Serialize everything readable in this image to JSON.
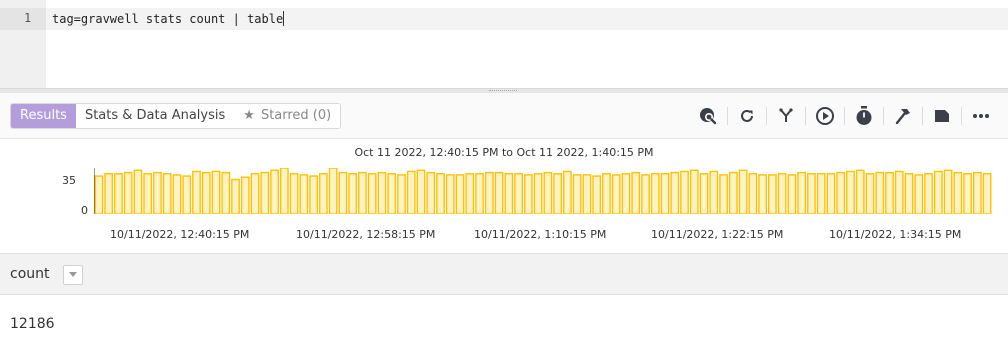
{
  "editor": {
    "line_number": "1",
    "query": "tag=gravwell stats count | table"
  },
  "tabs": {
    "results": "Results",
    "stats": "Stats & Data Analysis",
    "starred": "Starred (0)"
  },
  "toolbar_icons": [
    "search-overview-icon",
    "refresh-icon",
    "fork-icon",
    "play-icon",
    "stopwatch-icon",
    "hammer-icon",
    "label-icon",
    "more-icon"
  ],
  "histogram": {
    "range_label": "Oct 11 2022, 12:40:15 PM to Oct 11 2022, 1:40:15 PM",
    "y_ticks": [
      "35",
      "0"
    ],
    "x_ticks": [
      "10/11/2022, 12:40:15 PM",
      "10/11/2022, 12:58:15 PM",
      "10/11/2022, 1:10:15 PM",
      "10/11/2022, 1:22:15 PM",
      "10/11/2022, 1:34:15 PM"
    ],
    "bar_color": "#ffc107",
    "bar_fill": "#fff3c4"
  },
  "chart_data": {
    "type": "bar",
    "title": "Oct 11 2022, 12:40:15 PM to Oct 11 2022, 1:40:15 PM",
    "ylim": [
      0,
      40
    ],
    "values": [
      33,
      35,
      35,
      36,
      38,
      35,
      36,
      35,
      34,
      33,
      37,
      36,
      37,
      36,
      30,
      32,
      35,
      36,
      38,
      40,
      35,
      34,
      33,
      35,
      40,
      36,
      35,
      36,
      35,
      36,
      35,
      34,
      37,
      38,
      36,
      35,
      34,
      34,
      35,
      35,
      36,
      36,
      35,
      35,
      34,
      35,
      36,
      35,
      37,
      34,
      34,
      33,
      35,
      34,
      35,
      36,
      34,
      35,
      35,
      36,
      37,
      38,
      35,
      37,
      34,
      36,
      38,
      35,
      34,
      34,
      35,
      34,
      36,
      35,
      35,
      35,
      36,
      37,
      38,
      35,
      36,
      36,
      37,
      35,
      34,
      35,
      37,
      38,
      36,
      35,
      36,
      35
    ]
  },
  "table": {
    "column": "count",
    "value": "12186"
  }
}
